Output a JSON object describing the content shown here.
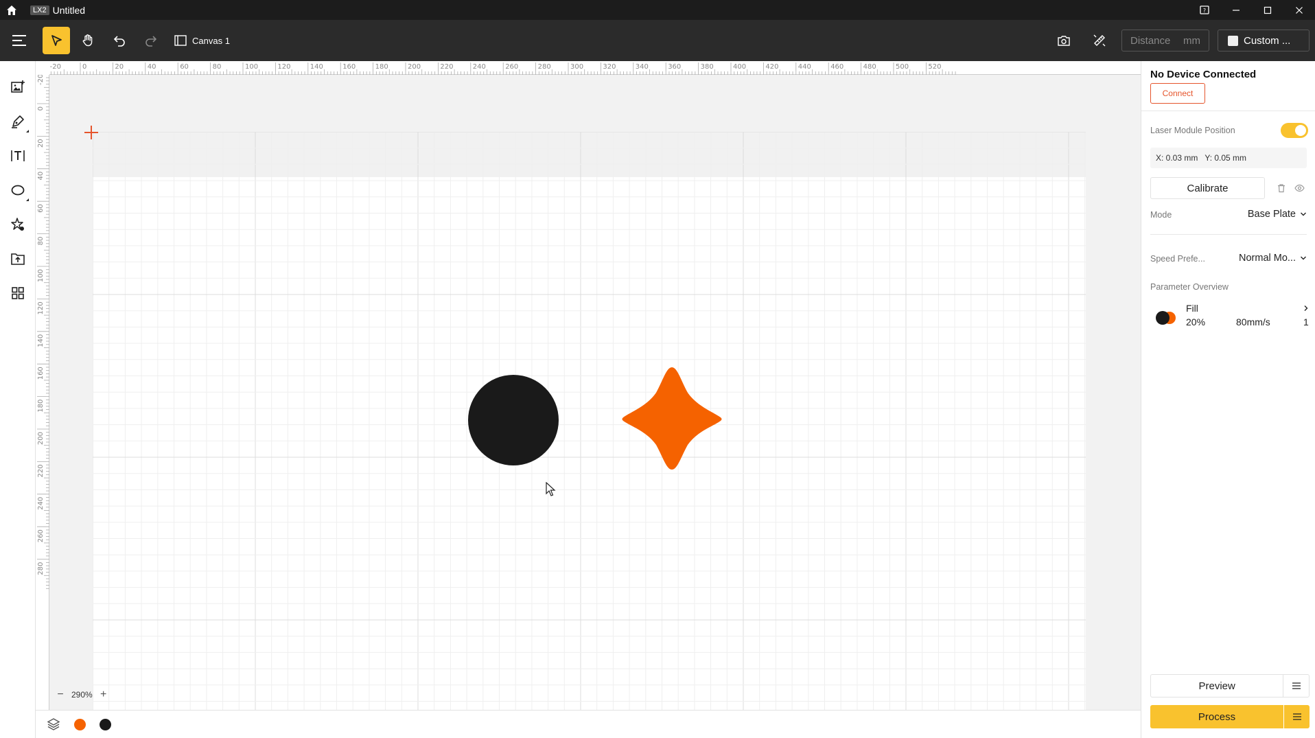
{
  "titlebar": {
    "app_badge": "LX2",
    "doc_title": "Untitled",
    "icons": [
      "home-icon",
      "help-icon",
      "minimize-icon",
      "maximize-icon",
      "close-icon"
    ]
  },
  "toolbar": {
    "canvas_label": "Canvas 1",
    "distance_placeholder": "Distance",
    "distance_unit": "mm",
    "custom_label": "Custom ..."
  },
  "ruler": {
    "top_ticks": [
      "-20",
      "0",
      "20",
      "40",
      "60",
      "80",
      "100",
      "120",
      "140",
      "160",
      "180",
      "200",
      "220",
      "240",
      "260",
      "280",
      "300",
      "320",
      "340",
      "360",
      "380",
      "400",
      "420",
      "440",
      "460",
      "480",
      "500",
      "520"
    ],
    "left_ticks": [
      "-20",
      "0",
      "20",
      "40",
      "60",
      "80",
      "100",
      "120",
      "140",
      "160",
      "180",
      "200",
      "220",
      "240",
      "260",
      "280"
    ]
  },
  "canvas": {
    "zoom_level": "290%",
    "shape_colors": {
      "circle": "#1a1a1a",
      "star": "#f56200"
    }
  },
  "layers": [
    {
      "color": "#f56200"
    },
    {
      "color": "#1a1a1a"
    }
  ],
  "panel": {
    "device_status": "No Device Connected",
    "connect_label": "Connect",
    "laser_position_label": "Laser Module Position",
    "laser_position_enabled": true,
    "coord_x": "X: 0.03 mm",
    "coord_y": "Y: 0.05 mm",
    "calibrate_label": "Calibrate",
    "mode_label": "Mode",
    "mode_value": "Base Plate",
    "speed_label": "Speed Prefe...",
    "speed_value": "Normal Mo...",
    "param_overview_label": "Parameter Overview",
    "param": {
      "type": "Fill",
      "power": "20%",
      "speed": "80mm/s",
      "passes": "1"
    },
    "preview_label": "Preview",
    "process_label": "Process"
  },
  "colors": {
    "accent": "#f9c22e",
    "danger": "#e5542b",
    "orange": "#f56200"
  }
}
